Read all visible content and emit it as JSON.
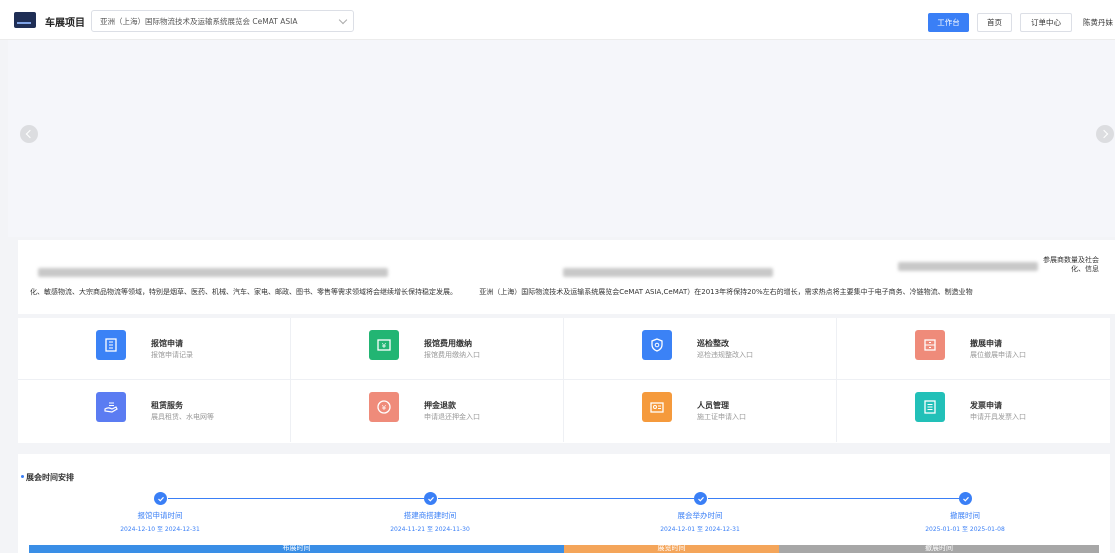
{
  "header": {
    "app_title": "车展项目",
    "project_select": {
      "value": "亚洲（上海）国际物流技术及运输系统展览会 CeMAT ASIA"
    },
    "nav": {
      "workbench": "工作台",
      "home": "首页",
      "orders": "订单中心"
    },
    "user_name": "陈黄丹妹"
  },
  "banner": {
    "prev_icon": "chevron-left-icon",
    "next_icon": "chevron-right-icon"
  },
  "intro": {
    "right_fragment": "参展商数量及社会化、信息",
    "line_segment_1": "化、敏感物流、大宗商品物流等领域，特别是烟草、医药、机械、汽车、家电、邮政、图书、零售等需求领域将会继续增长保持稳定发展。",
    "line_segment_2": "亚洲（上海）国际物流技术及运输系统展览会CeMAT ASIA,CeMAT）在2013年将保持20%左右的增长，需求热点将主要集中于电子商务、冷链物流、制造业物"
  },
  "services": [
    {
      "title": "报馆申请",
      "subtitle": "报馆申请记录",
      "icon": "building-icon",
      "color": "#3b82f6"
    },
    {
      "title": "报馆费用缴纳",
      "subtitle": "报馆费用缴纳入口",
      "icon": "payment-icon",
      "color": "#22b573"
    },
    {
      "title": "巡检整改",
      "subtitle": "巡检违规整改入口",
      "icon": "shield-icon",
      "color": "#3b82f6"
    },
    {
      "title": "撤展申请",
      "subtitle": "展位撤展申请入口",
      "icon": "cabinet-icon",
      "color": "#ef8b7a"
    },
    {
      "title": "租赁服务",
      "subtitle": "展具租赁、水电网等",
      "icon": "hand-coin-icon",
      "color": "#5b7cf2"
    },
    {
      "title": "押金退款",
      "subtitle": "申请退还押金入口",
      "icon": "refund-icon",
      "color": "#ef8b7a"
    },
    {
      "title": "人员管理",
      "subtitle": "施工证申请入口",
      "icon": "id-card-icon",
      "color": "#f59a3c"
    },
    {
      "title": "发票申请",
      "subtitle": "申请开具发票入口",
      "icon": "invoice-icon",
      "color": "#22c0b8"
    }
  ],
  "schedule": {
    "title": "展会时间安排",
    "steps": [
      {
        "label": "报馆申请时间",
        "date": "2024-12-10 至 2024-12-31"
      },
      {
        "label": "搭建商搭建时间",
        "date": "2024-11-21 至 2024-11-30"
      },
      {
        "label": "展会举办时间",
        "date": "2024-12-01 至 2024-12-31"
      },
      {
        "label": "撤展时间",
        "date": "2025-01-01 至 2025-01-08"
      }
    ],
    "phases": [
      {
        "label": "布展时间",
        "color": "#3a8ee6"
      },
      {
        "label": "展览时间",
        "color": "#f4a55a"
      },
      {
        "label": "撤展时间",
        "color": "#a7a7a7"
      }
    ]
  }
}
